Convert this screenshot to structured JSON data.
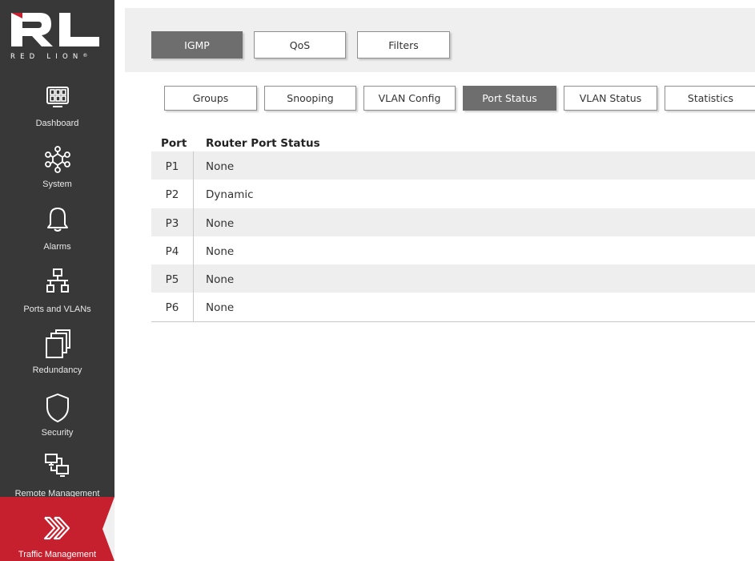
{
  "brand": {
    "letters": "RL",
    "wordmark": "RED LION",
    "mark": "®"
  },
  "colors": {
    "sidebar": "#383838",
    "active_nav": "#c6202e",
    "active_tab": "#6e6e6e"
  },
  "sidebar": {
    "items": [
      {
        "label": "Dashboard",
        "icon": "dashboard-icon"
      },
      {
        "label": "System",
        "icon": "network-nodes-icon"
      },
      {
        "label": "Alarms",
        "icon": "bell-icon"
      },
      {
        "label": "Ports and VLANs",
        "icon": "ports-tree-icon"
      },
      {
        "label": "Redundancy",
        "icon": "stacked-windows-icon"
      },
      {
        "label": "Security",
        "icon": "shield-icon"
      },
      {
        "label": "Remote Management",
        "icon": "remote-screens-icon"
      },
      {
        "label": "Traffic Management",
        "icon": "double-chevron-icon",
        "active": true
      }
    ]
  },
  "top_tabs": [
    {
      "label": "IGMP",
      "active": true
    },
    {
      "label": "QoS"
    },
    {
      "label": "Filters"
    }
  ],
  "sub_tabs": [
    {
      "label": "Groups"
    },
    {
      "label": "Snooping"
    },
    {
      "label": "VLAN Config"
    },
    {
      "label": "Port Status",
      "active": true
    },
    {
      "label": "VLAN Status"
    },
    {
      "label": "Statistics"
    }
  ],
  "table": {
    "headers": {
      "port": "Port",
      "status": "Router Port Status"
    },
    "rows": [
      {
        "port": "P1",
        "status": "None"
      },
      {
        "port": "P2",
        "status": "Dynamic"
      },
      {
        "port": "P3",
        "status": "None"
      },
      {
        "port": "P4",
        "status": "None"
      },
      {
        "port": "P5",
        "status": "None"
      },
      {
        "port": "P6",
        "status": "None"
      }
    ]
  }
}
